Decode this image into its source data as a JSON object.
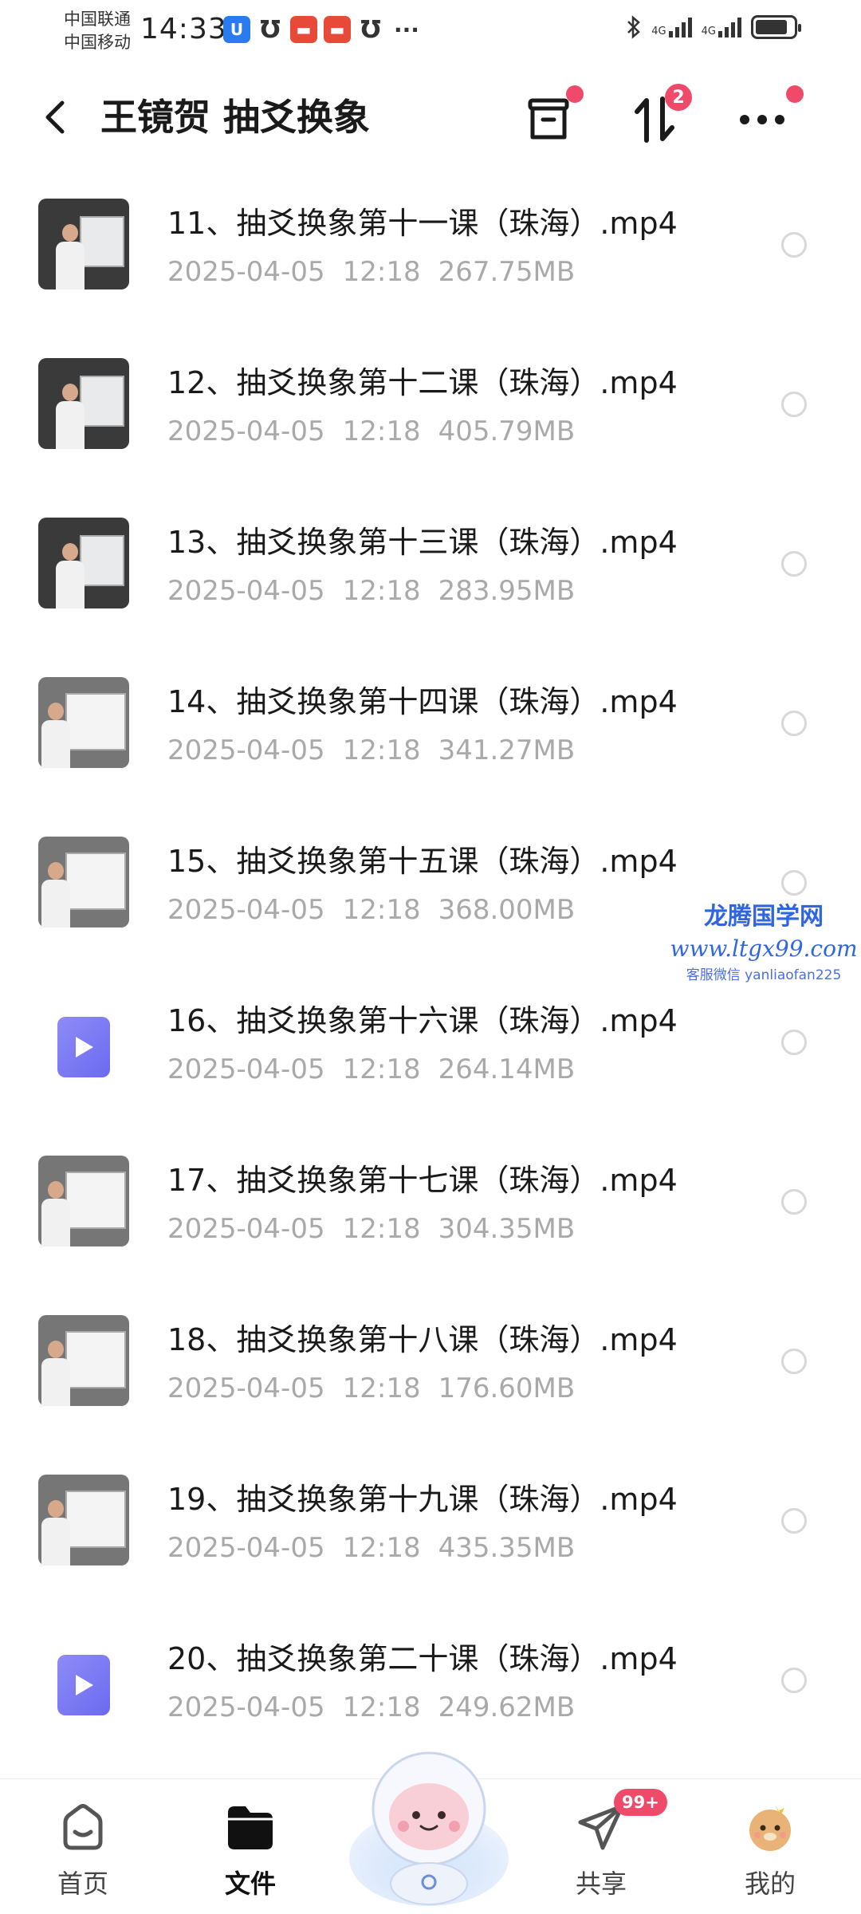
{
  "status_bar": {
    "carrier_1": "中国联通",
    "carrier_2": "中国移动",
    "time": "14:33",
    "network_1": "4G",
    "network_2": "4G",
    "battery_level": 0.85
  },
  "header": {
    "title": "王镜贺 抽爻换象",
    "sort_badge_count": "2"
  },
  "files": [
    {
      "name": "11、抽爻换象第十一课（珠海）.mp4",
      "date": "2025-04-05",
      "time": "12:18",
      "size": "267.75MB",
      "thumb": "video-frame"
    },
    {
      "name": "12、抽爻换象第十二课（珠海）.mp4",
      "date": "2025-04-05",
      "time": "12:18",
      "size": "405.79MB",
      "thumb": "video-frame"
    },
    {
      "name": "13、抽爻换象第十三课（珠海）.mp4",
      "date": "2025-04-05",
      "time": "12:18",
      "size": "283.95MB",
      "thumb": "video-frame"
    },
    {
      "name": "14、抽爻换象第十四课（珠海）.mp4",
      "date": "2025-04-05",
      "time": "12:18",
      "size": "341.27MB",
      "thumb": "video-frame"
    },
    {
      "name": "15、抽爻换象第十五课（珠海）.mp4",
      "date": "2025-04-05",
      "time": "12:18",
      "size": "368.00MB",
      "thumb": "video-frame"
    },
    {
      "name": "16、抽爻换象第十六课（珠海）.mp4",
      "date": "2025-04-05",
      "time": "12:18",
      "size": "264.14MB",
      "thumb": "play-icon"
    },
    {
      "name": "17、抽爻换象第十七课（珠海）.mp4",
      "date": "2025-04-05",
      "time": "12:18",
      "size": "304.35MB",
      "thumb": "video-frame"
    },
    {
      "name": "18、抽爻换象第十八课（珠海）.mp4",
      "date": "2025-04-05",
      "time": "12:18",
      "size": "176.60MB",
      "thumb": "video-frame"
    },
    {
      "name": "19、抽爻换象第十九课（珠海）.mp4",
      "date": "2025-04-05",
      "time": "12:18",
      "size": "435.35MB",
      "thumb": "video-frame"
    },
    {
      "name": "20、抽爻换象第二十课（珠海）.mp4",
      "date": "2025-04-05",
      "time": "12:18",
      "size": "249.62MB",
      "thumb": "play-icon"
    }
  ],
  "watermark": {
    "name": "龙腾国学网",
    "url": "www.ltgx99.com",
    "contact": "客服微信 yanliaofan225"
  },
  "bottom_nav": {
    "home_label": "首页",
    "files_label": "文件",
    "share_label": "共享",
    "share_badge": "99+",
    "mine_label": "我的"
  },
  "colors": {
    "accent_badge": "#f04a6a",
    "play_icon": "#7b79f3",
    "meta_text": "#a9a9a9",
    "watermark": "#2f66e0"
  }
}
